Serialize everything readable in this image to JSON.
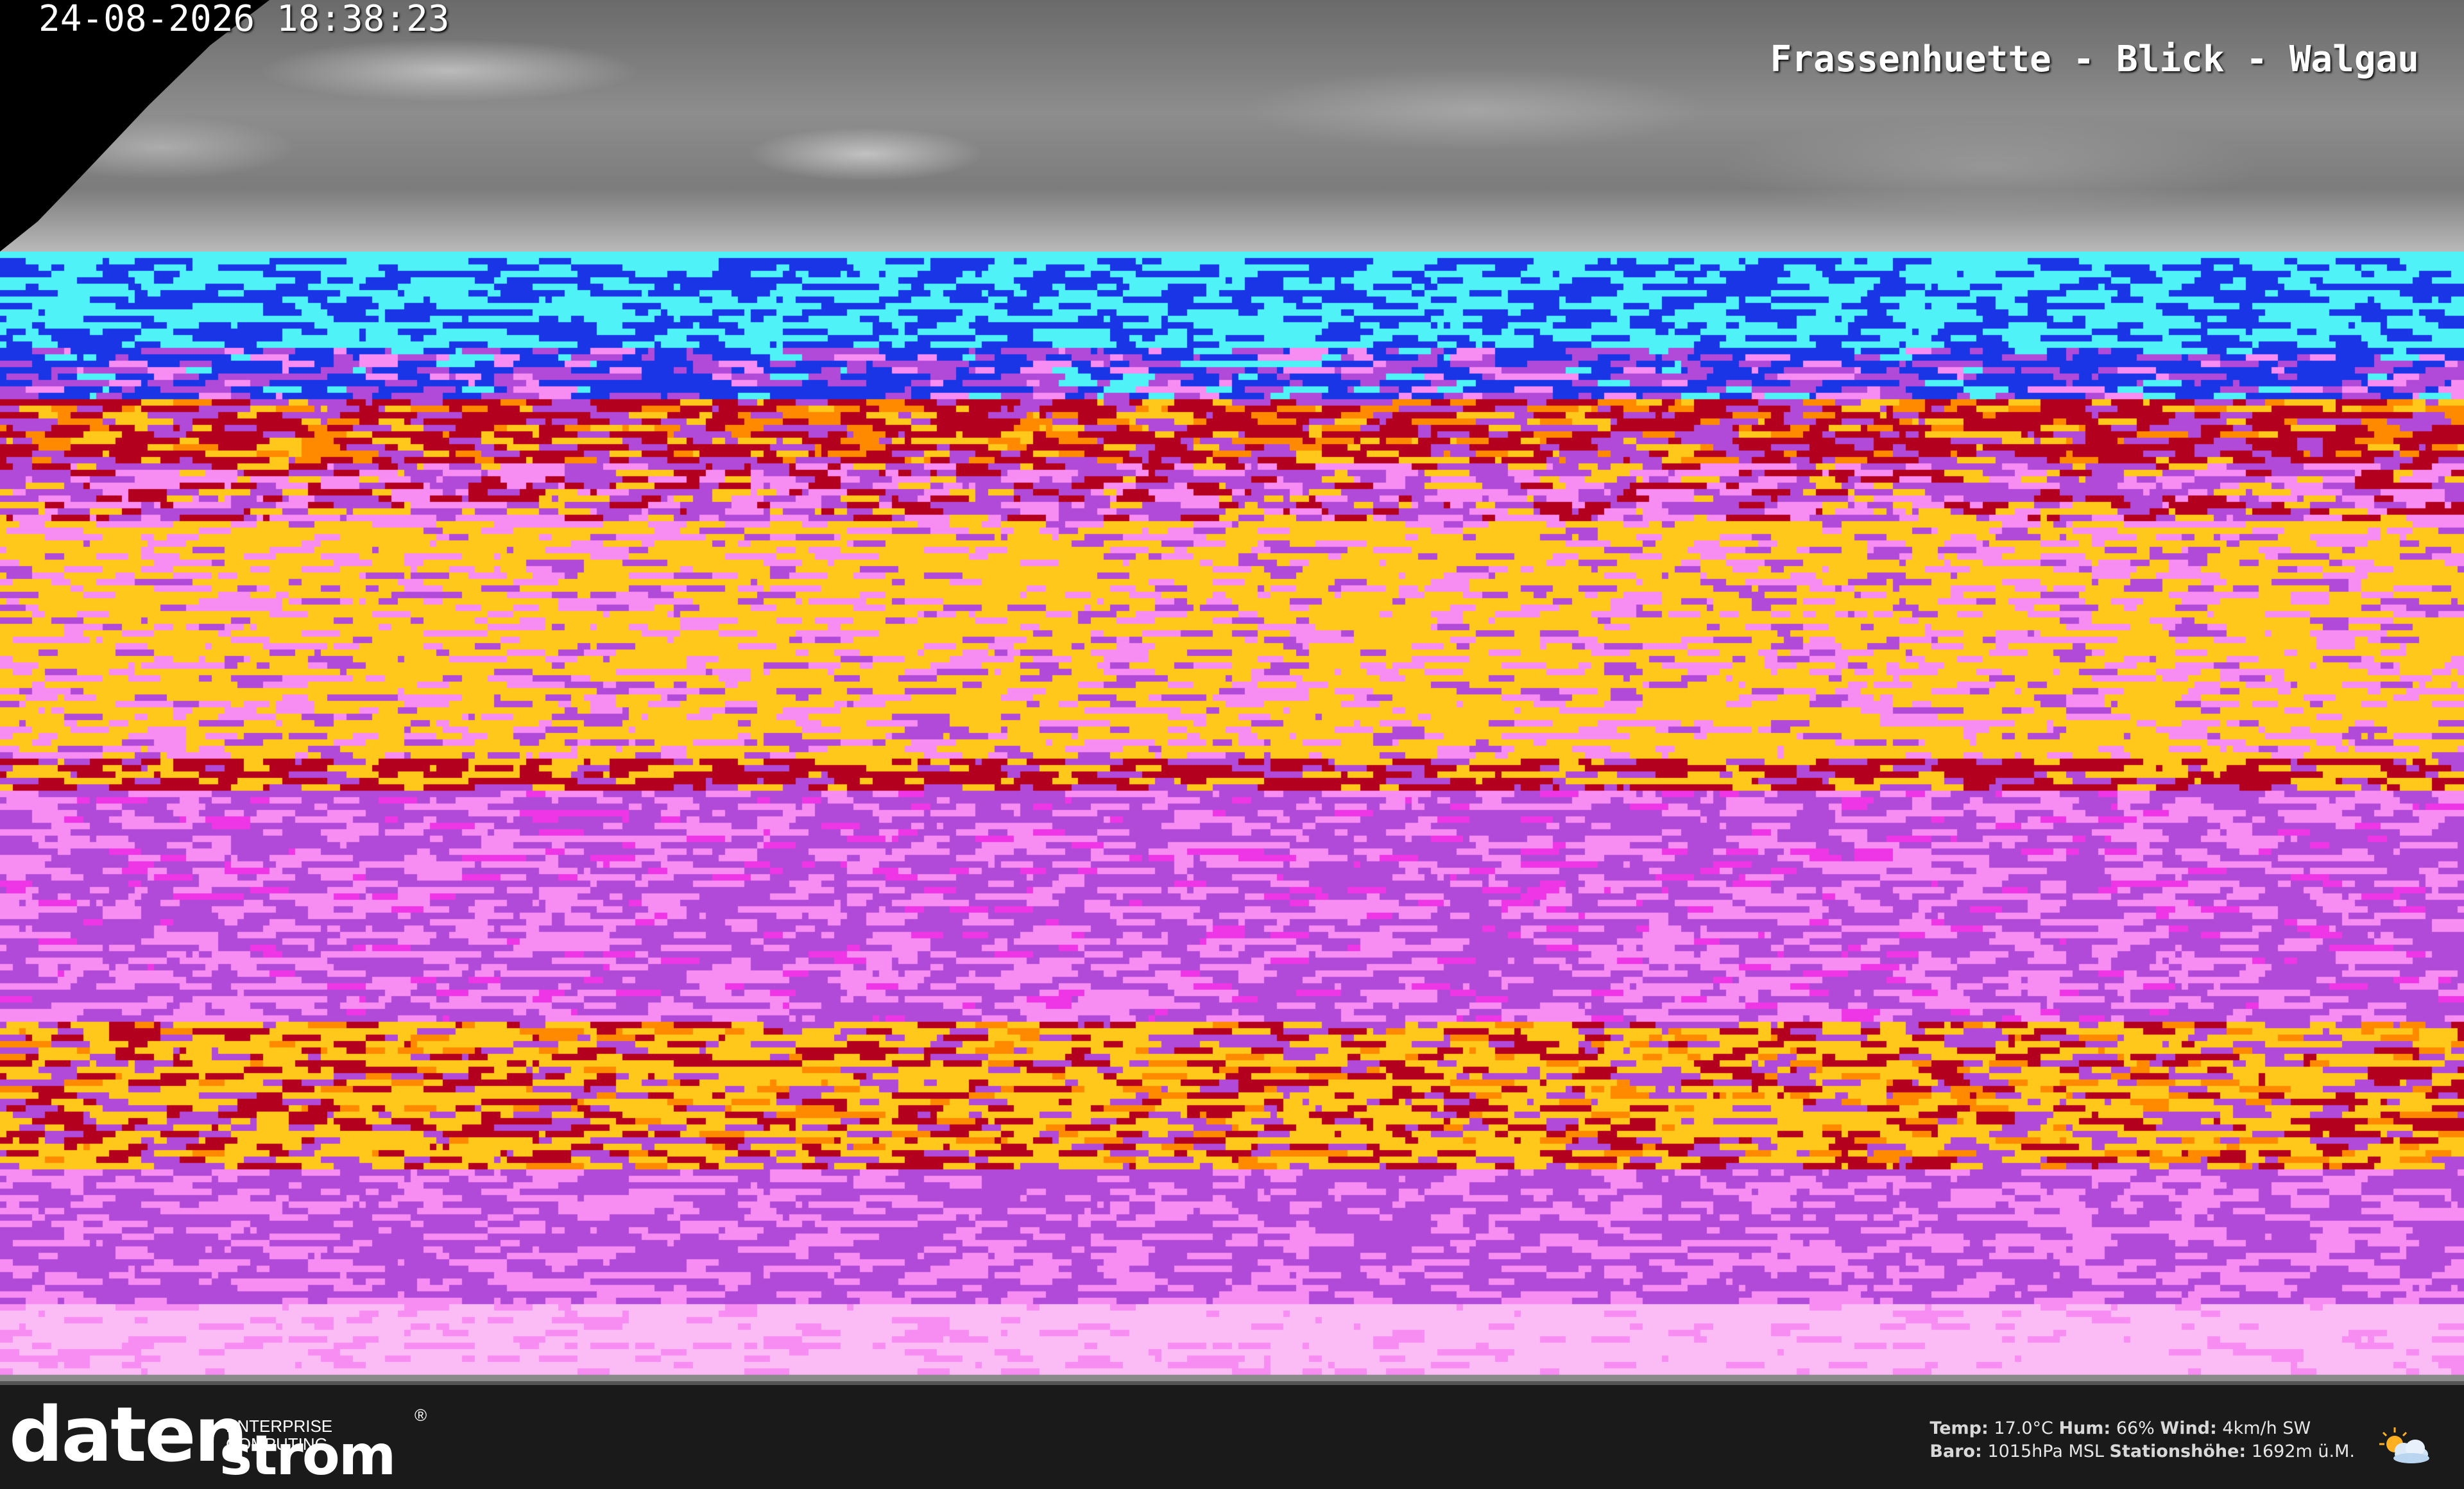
{
  "overlay": {
    "timestamp": "24-08-2026 18:38:23",
    "camera_title": "Frassenhuette - Blick - Walgau"
  },
  "logo": {
    "word_top": "daten",
    "word_bottom": "strom",
    "tagline": "ENTERPRISE COMPUTING",
    "registered": "®"
  },
  "weather": {
    "temp_label": "Temp:",
    "temp_value": "17.0°C",
    "hum_label": "Hum:",
    "hum_value": "66%",
    "wind_label": "Wind:",
    "wind_value": "4km/h SW",
    "baro_label": "Baro:",
    "baro_value": "1015hPa MSL",
    "elev_label": "Stationshöhe:",
    "elev_value": "1692m ü.M.",
    "icon": "partly-cloudy-icon"
  },
  "colors": {
    "cyan": "#4ef2f7",
    "blue": "#1a35e6",
    "dark_red": "#b3001e",
    "orange": "#ff8a00",
    "yellow": "#ffc81a",
    "purple": "#b14ad8",
    "pink": "#f78cf2",
    "magenta": "#ee36e6",
    "light_pink": "#fbbcf6"
  }
}
